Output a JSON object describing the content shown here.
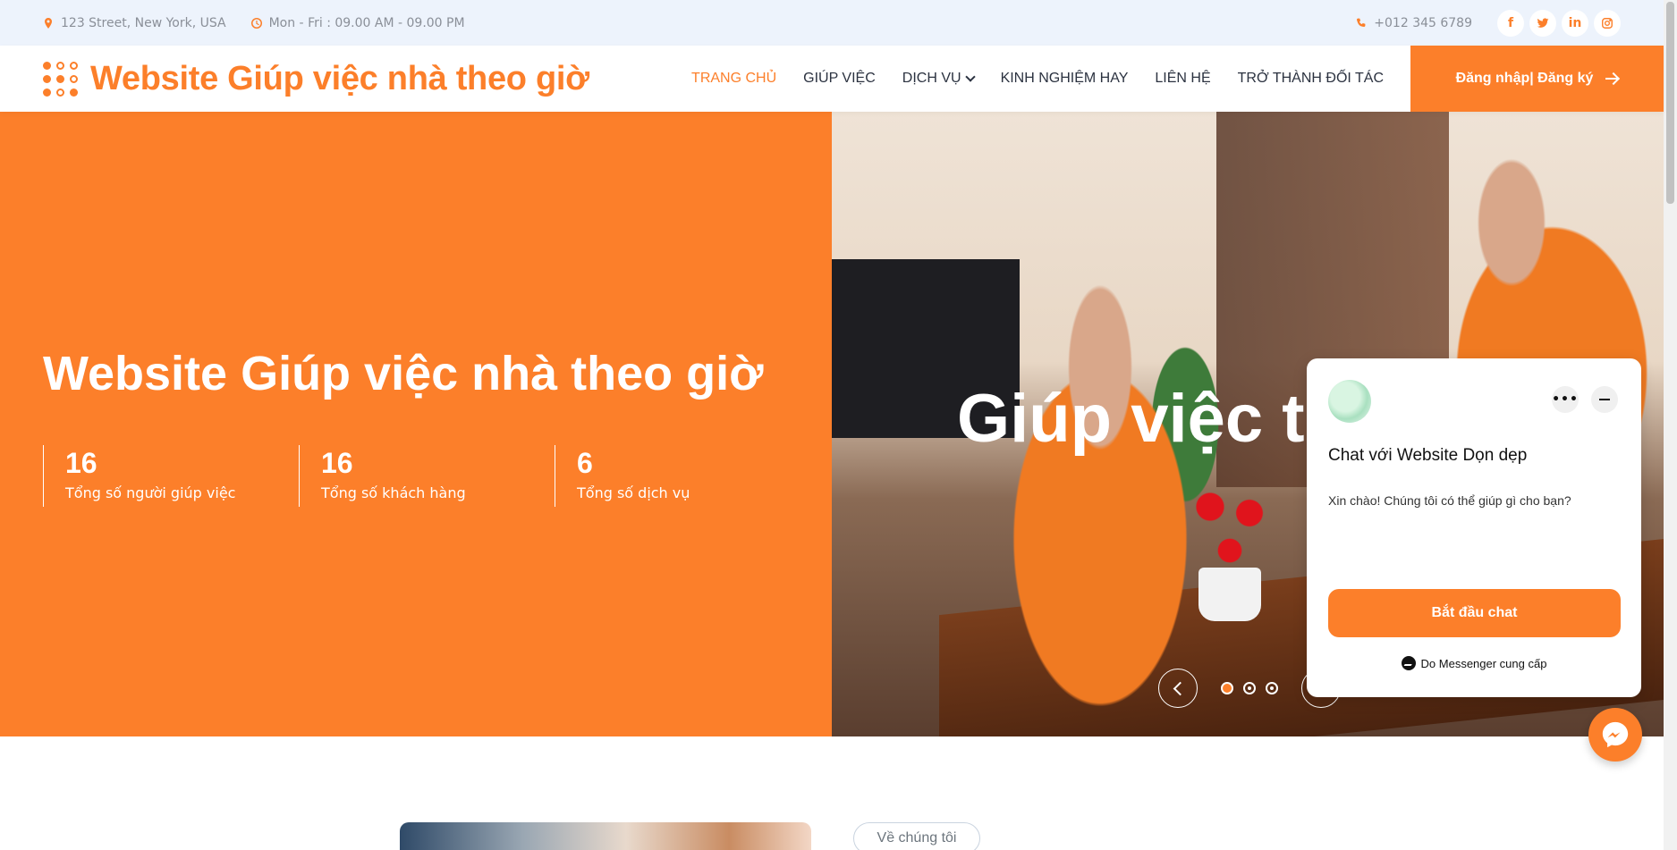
{
  "topbar": {
    "address": "123 Street, New York, USA",
    "hours": "Mon - Fri : 09.00 AM - 09.00 PM",
    "phone": "+012 345 6789",
    "social": [
      "f",
      "t",
      "in",
      "ig"
    ]
  },
  "navbar": {
    "brand": "Website Giúp việc nhà theo giờ",
    "menu": [
      {
        "label": "TRANG CHỦ",
        "active": true
      },
      {
        "label": "GIÚP VIỆC"
      },
      {
        "label": "DỊCH VỤ",
        "dropdown": true
      },
      {
        "label": "KINH NGHIỆM HAY"
      },
      {
        "label": "LIÊN HỆ"
      },
      {
        "label": "TRỞ THÀNH ĐỐI TÁC"
      }
    ],
    "login_label": "Đăng nhập| Đăng ký"
  },
  "hero": {
    "title": "Website Giúp việc nhà theo giờ",
    "stats": [
      {
        "value": "16",
        "label": "Tổng số người giúp việc"
      },
      {
        "value": "16",
        "label": "Tổng số khách hàng"
      },
      {
        "value": "6",
        "label": "Tổng số dịch vụ"
      }
    ],
    "slide_text": "Giúp việc t",
    "slide_active": 1,
    "slide_count": 3
  },
  "chat": {
    "title": "Chat với Website Dọn dẹp",
    "message": "Xin chào! Chúng tôi có thể giúp gì cho bạn?",
    "start_label": "Bắt đầu chat",
    "powered": "Do Messenger cung cấp",
    "more": "•••"
  },
  "about": {
    "tag": "Về chúng tôi"
  },
  "colors": {
    "accent": "#fc7f2a",
    "topbar_bg": "#edf3fc",
    "text_dark": "#2b3240"
  }
}
